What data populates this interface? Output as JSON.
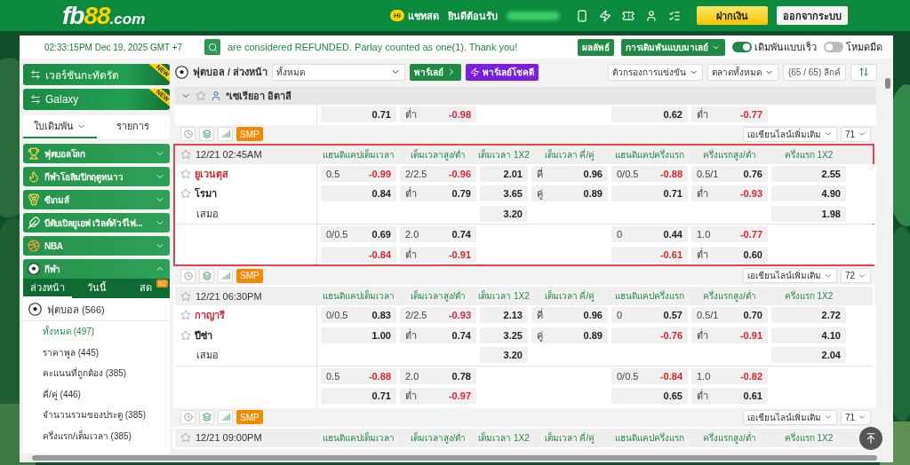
{
  "header": {
    "logo": {
      "main": "fb",
      "accent": "88",
      "suffix": ".com"
    },
    "chat": {
      "badge": "Hi",
      "label": "แชทสด"
    },
    "welcome": "ยินดีต้อนรับ",
    "deposit": "ฝากเงิน",
    "logout": "ออกจากระบบ"
  },
  "info_bar": {
    "clock": "02:33:15PM Dec 19, 2025 GMT +7",
    "ticker": "are considered REFUNDED. Parlay counted as one(1). Thank you!",
    "results": "ผลลัพธ์",
    "odds_type": "การเดิมพันแบบมาเลย์",
    "toggles": [
      {
        "label": "เดิมพันแบบเร็ว",
        "on": true
      },
      {
        "label": "โหมดมืด",
        "on": false
      }
    ]
  },
  "sidebar": {
    "banners": [
      {
        "label": "เวอร์ชันกะทัดรัด",
        "badge": "NEW"
      },
      {
        "label": "Galaxy",
        "badge": "NEW"
      }
    ],
    "tabs": [
      {
        "label": "ใบเดิมพัน",
        "selected": true
      },
      {
        "label": "รายการ",
        "selected": false
      }
    ],
    "sports": [
      {
        "label": "ฟุตบอลโลก",
        "kind": "trophy",
        "expanded": false
      },
      {
        "label": "กีฬาโอลิมปิกฤดูหนาว",
        "kind": "torch",
        "expanded": false
      },
      {
        "label": "ซีเกมส์",
        "kind": "medal",
        "expanded": false
      },
      {
        "label": "บีดับเบิลยูเอฟ เวิลด์ทัวร์ไฟ...",
        "kind": "shuttlecock",
        "expanded": false
      },
      {
        "label": "NBA",
        "kind": "basketball",
        "expanded": false
      },
      {
        "label": "กีฬา",
        "kind": "ball",
        "expanded": true
      }
    ],
    "period_tabs": [
      {
        "label": "ล่วงหน้า",
        "selected": true
      },
      {
        "label": "วันนี้",
        "selected": false
      },
      {
        "label": "สด",
        "selected": false,
        "badge": "92"
      }
    ],
    "sport_list": {
      "label": "ฟุตบอล (566)",
      "children": [
        {
          "label": "ทั้งหมด (497)",
          "selected": true
        },
        {
          "label": "ราคาพูล (445)",
          "selected": false
        },
        {
          "label": "คะแนนที่ถูกต้อง (385)",
          "selected": false
        },
        {
          "label": "คี่/คู่ (446)",
          "selected": false
        },
        {
          "label": "จำนวนรวมของประตู (385)",
          "selected": false
        },
        {
          "label": "ครึ่งแรก/เต็มเวลา (385)",
          "selected": false
        }
      ]
    }
  },
  "toolbar": {
    "title": "ฟุตบอล / ล่วงหน้า",
    "filter": "ทั้งหมด",
    "parlay": "พาร์เลย์",
    "lucky_parlay": "พาร์เลย์โชคดี",
    "competition_filter": "ตัวกรองการแข่งขัน",
    "market": "ตลาดทั้งหมด",
    "league_count": "(65 / 65) ลีกค์"
  },
  "league": {
    "name": "*เซเรียอา อิตาลี",
    "expanded": true
  },
  "previous_match_rows": [
    {
      "cells": [
        {
          "odds": "0.71"
        },
        {
          "line": "ต่ำ",
          "odds": "-0.98"
        },
        null,
        null,
        {
          "odds": "0.62"
        },
        {
          "line": "ต่ำ",
          "odds": "-0.77"
        },
        null
      ]
    }
  ],
  "matches": [
    {
      "tools": {
        "smp": "SMP",
        "more_lines": "เอเชียนไลน์เพิ่มเติม",
        "count": "71"
      },
      "highlighted": true,
      "time": "12/21 02:45AM",
      "columns": [
        "แฮนดิแคปเต็มเวลา",
        "เต็มเวลาสูง/ต่ำ",
        "เต็มเวลา 1X2",
        "เต็มเวลา คี่/คู่",
        "แฮนดิแคปครึ่งแรก",
        "ครึ่งแรกสูง/ต่ำ",
        "ครึ่งแรก 1X2"
      ],
      "rows": [
        {
          "kind": "team",
          "team": "ยูเวนตุส",
          "favorite": true,
          "cells": [
            {
              "line": "0.5",
              "odds": "-0.99"
            },
            {
              "line": "2/2.5",
              "odds": "-0.96"
            },
            {
              "odds": "2.01"
            },
            {
              "line": "คี่",
              "odds": "0.96"
            },
            {
              "line": "0/0.5",
              "odds": "-0.88"
            },
            {
              "line": "0.5/1",
              "odds": "0.76"
            },
            {
              "odds": "2.55"
            }
          ]
        },
        {
          "kind": "team",
          "team": "โรมา",
          "favorite": false,
          "cells": [
            {
              "odds": "0.84"
            },
            {
              "line": "ต่ำ",
              "odds": "0.79"
            },
            {
              "odds": "3.65"
            },
            {
              "line": "คู่",
              "odds": "0.89"
            },
            {
              "odds": "0.71"
            },
            {
              "line": "ต่ำ",
              "odds": "-0.93"
            },
            {
              "odds": "4.90"
            }
          ]
        },
        {
          "kind": "draw",
          "team": "เสมอ",
          "cells": [
            null,
            null,
            {
              "odds": "3.20"
            },
            null,
            null,
            null,
            {
              "odds": "1.98"
            }
          ]
        }
      ],
      "extra_rows": [
        {
          "cells": [
            {
              "line": "0/0.5",
              "odds": "0.69"
            },
            {
              "line": "2.0",
              "odds": "0.74"
            },
            null,
            null,
            {
              "line": "0",
              "odds": "0.44"
            },
            {
              "line": "1.0",
              "odds": "-0.77"
            },
            null
          ]
        },
        {
          "cells": [
            {
              "odds": "-0.84"
            },
            {
              "line": "ต่ำ",
              "odds": "-0.91"
            },
            null,
            null,
            {
              "odds": "-0.61"
            },
            {
              "line": "ต่ำ",
              "odds": "0.60"
            },
            null
          ]
        }
      ]
    },
    {
      "tools": {
        "smp": "SMP",
        "more_lines": "เอเชียนไลน์เพิ่มเติม",
        "count": "72"
      },
      "highlighted": false,
      "time": "12/21 06:30PM",
      "columns": [
        "แฮนดิแคปเต็มเวลา",
        "เต็มเวลาสูง/ต่ำ",
        "เต็มเวลา 1X2",
        "เต็มเวลา คี่/คู่",
        "แฮนดิแคปครึ่งแรก",
        "ครึ่งแรกสูง/ต่ำ",
        "ครึ่งแรก 1X2"
      ],
      "rows": [
        {
          "kind": "team",
          "team": "กาญารี",
          "favorite": true,
          "cells": [
            {
              "line": "0/0.5",
              "odds": "0.83"
            },
            {
              "line": "2/2.5",
              "odds": "-0.93"
            },
            {
              "odds": "2.13"
            },
            {
              "line": "คี่",
              "odds": "0.96"
            },
            {
              "line": "0",
              "odds": "0.57"
            },
            {
              "line": "0.5/1",
              "odds": "0.70"
            },
            {
              "odds": "2.72"
            }
          ]
        },
        {
          "kind": "team",
          "team": "ปีซ่า",
          "favorite": false,
          "cells": [
            {
              "odds": "1.00"
            },
            {
              "line": "ต่ำ",
              "odds": "0.74"
            },
            {
              "odds": "3.25"
            },
            {
              "line": "คู่",
              "odds": "0.89"
            },
            {
              "odds": "-0.76"
            },
            {
              "line": "ต่ำ",
              "odds": "-0.91"
            },
            {
              "odds": "4.10"
            }
          ]
        },
        {
          "kind": "draw",
          "team": "เสมอ",
          "cells": [
            null,
            null,
            {
              "odds": "3.20"
            },
            null,
            null,
            null,
            {
              "odds": "2.04"
            }
          ]
        }
      ],
      "extra_rows": [
        {
          "cells": [
            {
              "line": "0.5",
              "odds": "-0.88"
            },
            {
              "line": "2.0",
              "odds": "0.78"
            },
            null,
            null,
            {
              "line": "0/0.5",
              "odds": "-0.84"
            },
            {
              "line": "1.0",
              "odds": "-0.82"
            },
            null
          ]
        },
        {
          "cells": [
            {
              "odds": "0.71"
            },
            {
              "line": "ต่ำ",
              "odds": "-0.97"
            },
            null,
            null,
            {
              "odds": "0.65"
            },
            {
              "line": "ต่ำ",
              "odds": "0.61"
            },
            null
          ]
        }
      ]
    },
    {
      "tools": {
        "smp": "SMP",
        "more_lines": "เอเชียนไลน์เพิ่มเติม",
        "count": "71"
      },
      "highlighted": false,
      "time": "12/21 09:00PM",
      "columns": [
        "แฮนดิแคปเต็มเวลา",
        "เต็มเวลาสูง/ต่ำ",
        "เต็มเวลา 1X2",
        "เต็มเวลา คี่/คู่",
        "แฮนดิแคปครึ่งแรก",
        "ครึ่งแรกสูง/ต่ำ",
        "ครึ่งแรก 1X2"
      ]
    }
  ]
}
